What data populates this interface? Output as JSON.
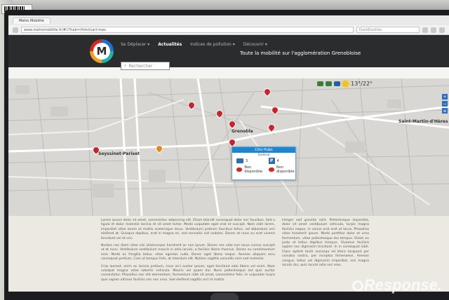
{
  "browser": {
    "tab_title": "Metro Mobilité",
    "address": "www.metromobilite.fr/#!/?hab=/html/cart-mes",
    "search_placeholder": "DuckDuckGo"
  },
  "app": {
    "logo_letter": "M",
    "nav": [
      {
        "label": "Se Déplacer ▾"
      },
      {
        "label": "Actualités",
        "active": true
      },
      {
        "label": "Indices de pollution ▾"
      },
      {
        "label": "Découvrir ▾"
      }
    ],
    "title": "Toute la mobilité sur l'agglomération Grenobloise",
    "search_label": "Rechercher"
  },
  "map": {
    "weather": {
      "temperature": "13°/22°"
    },
    "labels": [
      {
        "text": "Grenoble"
      },
      {
        "text": "Seyssinet-Pariset"
      },
      {
        "text": "Saint-Martin-d'Hères"
      }
    ],
    "popup": {
      "title": "Citiz Hubs",
      "subtitle": "Dudevat",
      "bikes": "3",
      "parking": "4",
      "cars_available": "Non disponible",
      "cars_unavailable": "Non disponible"
    }
  },
  "article": {
    "col1": [
      "Lorem ipsum dolor sit amet, consectetur adipiscing elit. Etiam blandit consequat dolor nec faucibus. Sed a ligula et dolor molestie lacinia et sit amet tortor. Morbi vulputate eget erat et suscipit. Nam nibh lorem, imperdiet vitae lorem et mattis scelerisque lacus. Vestibulum pretium faucibus tellus, vel bibendum orci eleifend at. Quisque dapibus, erat in magna mi, sed convallis nisl sodales. Donec at nunc eu erat viverra tincidunt vel et orci.",
      "Nullam nec diam vitae nisi ullamcorper hendrerit ac non ipsum. Donec nec odio non lacus cursus suscipit ut et nunc. Vestibulum vestibulum mauris in odio iaculis, a facilisis libero rhoncus. Donec eu condimentum eros. Morbi ac fringilla tellus, vitae egestas nulla. Donec eget libero neque. Aenean aliquam arcu consequat pretium. Cras ut tempus felis, at interdum elit. Nullam sagittis convallis sem sed molestie.",
      "Cras laoreet, enim ac lacinia pretium, risus orci auctor ipsum, eget tincidunt odio libero vel enim. Nam volutpat magna vitae lobortis vehicula. Mauris vel quam dui. Nunc pellentesque est quis auctor consectetur. Phasellus nec elit elementum, fermentum nibh sit amet, consectetur felis. In vulputate turpis quis sapien ultrices facilisis nec nec urna. Sed eleifend sagittis orci id mattis."
    ],
    "col2": [
      "Integer sed gravida velit. Pellentesque imperdiet, dolor sit amet vestibulum vehicula, turpis magna facilisis neque, in varius erat erat ut lacus. Phasellus vitae hendrerit ipsum. Morbi porttitor dolor et urna fermentum, vitae pellentesque leo tempus. Etiam eu justo et tellus dapibus tempus. Vivamus facilisis sapien nec dignissim tincidunt. In in consequat nibh. Class aptent taciti sociosqu ad litora torquent per conubia nostra, per inceptos himenaeos. Aenean congue, tellus vel dignissim imperdiet, nisi magna iaculis dui, quis iaculis odio nec eros."
    ]
  },
  "watermark": "Response."
}
